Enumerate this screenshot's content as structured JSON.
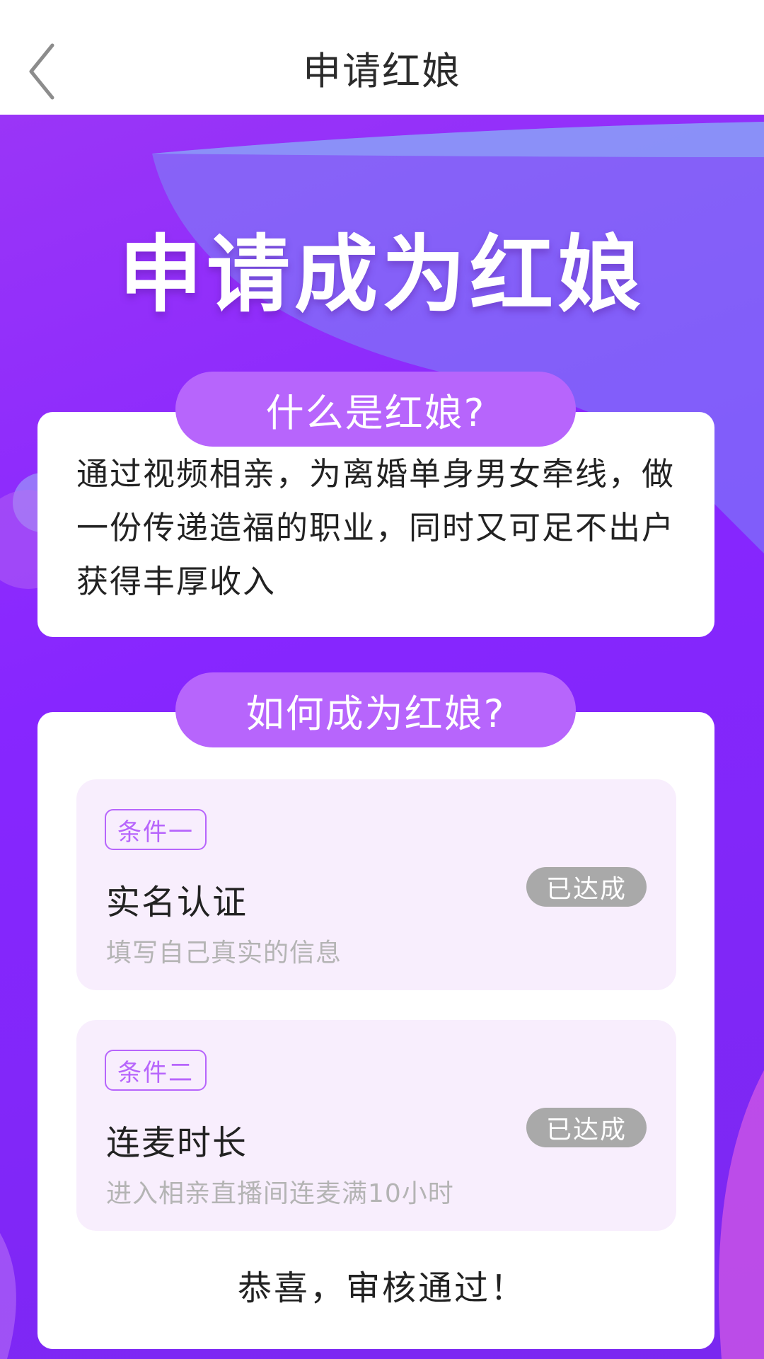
{
  "header": {
    "title": "申请红娘",
    "back_icon": "chevron-left-icon"
  },
  "hero": {
    "title": "申请成为红娘",
    "gradient_colors": [
      "#9a35f7",
      "#8726ff",
      "#7a28f0"
    ]
  },
  "what_section": {
    "heading": "什么是红娘?",
    "body": "通过视频相亲，为离婚单身男女牵线，做一份传递造福的职业，同时又可足不出户获得丰厚收入"
  },
  "how_section": {
    "heading": "如何成为红娘?",
    "conditions": [
      {
        "tag": "条件一",
        "title": "实名认证",
        "description": "填写自己真实的信息",
        "status": "已达成"
      },
      {
        "tag": "条件二",
        "title": "连麦时长",
        "description": "进入相亲直播间连麦满10小时",
        "status": "已达成"
      }
    ]
  },
  "result_text": "恭喜，审核通过！",
  "colors": {
    "accent": "#b765fc",
    "condition_bg": "#f8eefd",
    "status_bg": "#a9a9a9"
  }
}
